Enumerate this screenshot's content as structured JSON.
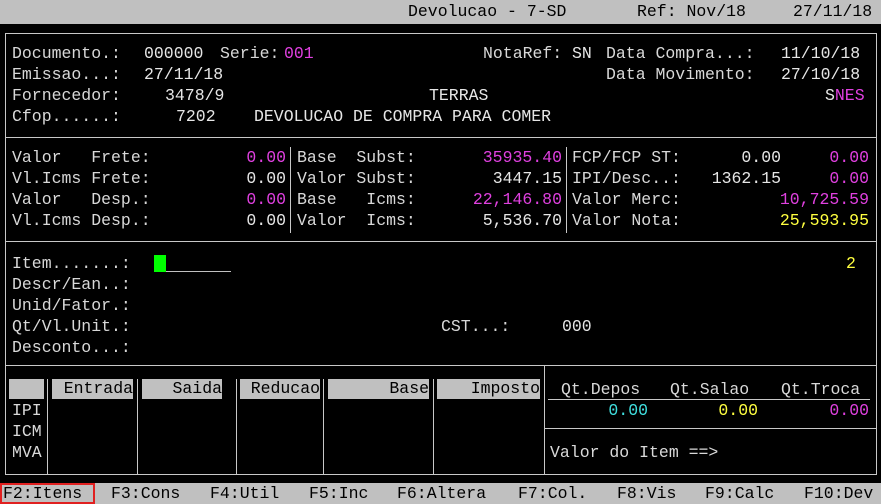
{
  "window": {
    "title": "Devolucao - 7-SD",
    "ref": "Ref: Nov/18",
    "date": "27/11/18"
  },
  "header": {
    "documento_label": "Documento.:",
    "documento": "000000",
    "serie_label": "Serie:",
    "serie": "001",
    "notaref_label": "NotaRef:",
    "notaref": "SN",
    "data_compra_label": "Data Compra...:",
    "data_compra": "11/10/18",
    "emissao_label": "Emissao...:",
    "emissao": "27/11/18",
    "data_mov_label": "Data Movimento:",
    "data_mov": "27/10/18",
    "fornecedor_label": "Fornecedor:",
    "fornecedor": "3478/9",
    "fornecedor_nome": "TERRAS",
    "snes_s": "S",
    "snes_rest": "NES",
    "cfop_label": "Cfop......:",
    "cfop": "7202",
    "cfop_desc": "DEVOLUCAO DE COMPRA PARA COMER"
  },
  "totals": {
    "c1": [
      {
        "label": "Valor   Frete:",
        "value": "0.00"
      },
      {
        "label": "Vl.Icms Frete:",
        "value": "0.00"
      },
      {
        "label": "Valor   Desp.:",
        "value": "0.00"
      },
      {
        "label": "Vl.Icms Desp.:",
        "value": "0.00"
      }
    ],
    "c2": [
      {
        "label": "Base  Subst:",
        "value": "35935.40"
      },
      {
        "label": "Valor Subst:",
        "value": "3447.15"
      },
      {
        "label": "Base   Icms:",
        "value": "22,146.80"
      },
      {
        "label": "Valor  Icms:",
        "value": "5,536.70"
      }
    ],
    "c3": [
      {
        "label": "FCP/FCP ST:",
        "v1": "0.00",
        "v2": "0.00"
      },
      {
        "label": "IPI/Desc..:",
        "v1": "1362.15",
        "v2": "0.00"
      },
      {
        "label": "Valor Merc:",
        "value": "10,725.59"
      },
      {
        "label": "Valor Nota:",
        "value": "25,593.95"
      }
    ]
  },
  "item": {
    "item_label": "Item.......:",
    "item_count": "2",
    "descr_label": "Descr/Ean..:",
    "unid_label": "Unid/Fator.:",
    "qt_label": "Qt/Vl.Unit.:",
    "cst_label": "CST...:",
    "cst_value": "000",
    "desconto_label": "Desconto...:"
  },
  "tax_table": {
    "headers": [
      "Entrada",
      "Saida",
      "Reducao",
      "Base",
      "Imposto"
    ],
    "rows": [
      "IPI",
      "ICM",
      "MVA"
    ]
  },
  "qty_panel": {
    "headers": [
      "Qt.Depos",
      "Qt.Salao",
      "Qt.Troca"
    ],
    "values": [
      "0.00",
      "0.00",
      "0.00"
    ],
    "valor_item_label": "Valor do Item ==>"
  },
  "function_keys": [
    {
      "key": "F2:Itens"
    },
    {
      "key": "F3:Cons"
    },
    {
      "key": "F4:Util"
    },
    {
      "key": "F5:Inc"
    },
    {
      "key": "F6:Altera"
    },
    {
      "key": "F7:Col."
    },
    {
      "key": "F8:Vis"
    },
    {
      "key": "F9:Calc"
    },
    {
      "key": "F10:Dev"
    }
  ]
}
